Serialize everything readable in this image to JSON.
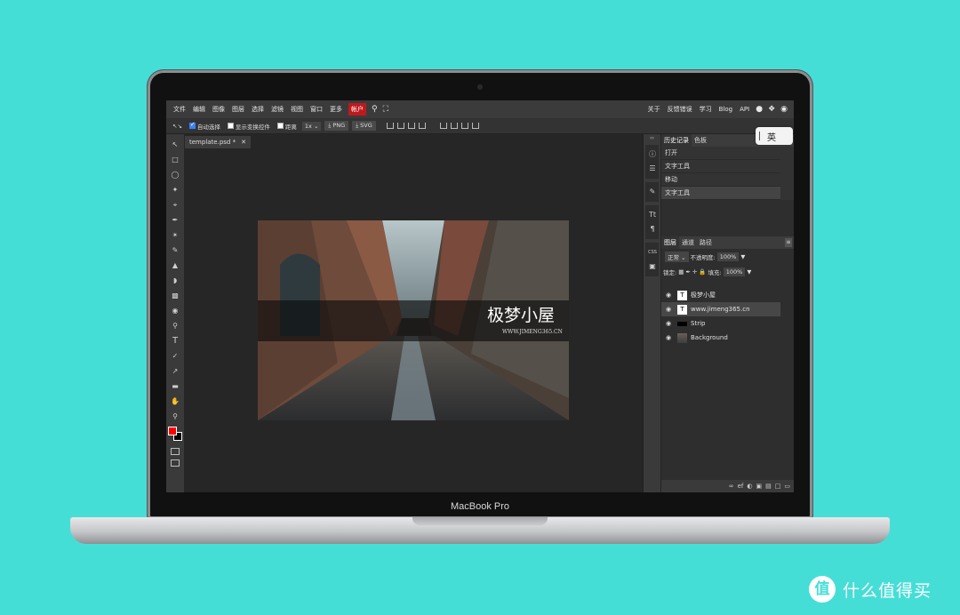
{
  "menubar": {
    "items": [
      "文件",
      "编辑",
      "图像",
      "图层",
      "选择",
      "滤镜",
      "视图",
      "窗口",
      "更多"
    ],
    "account": "帐户",
    "right_items": [
      "关于",
      "反馈错误",
      "学习",
      "Blog",
      "API"
    ]
  },
  "toolbar": {
    "auto_select": "自动选择",
    "show_transform": "显示变换控件",
    "distance": "距离",
    "zoom": "1x",
    "png": "PNG",
    "svg": "SVG"
  },
  "document_tab": "template.psd *",
  "canvas": {
    "title": "极梦小屋",
    "url": "WWW.JIMENG365.CN"
  },
  "history_panel": {
    "tabs": [
      "历史记录",
      "色板"
    ],
    "items": [
      "打开",
      "文字工具",
      "移动",
      "文字工具"
    ]
  },
  "layers_panel": {
    "tabs": [
      "图层",
      "通道",
      "路径"
    ],
    "blend_mode": "正常",
    "opacity_label": "不透明度:",
    "opacity_value": "100%",
    "lock_label": "锁定:",
    "fill_label": "填充:",
    "fill_value": "100%",
    "layers": [
      {
        "name": "极梦小屋",
        "thumb": "T"
      },
      {
        "name": "www.jimeng365.cn",
        "thumb": "T"
      },
      {
        "name": "Strip",
        "thumb": ""
      },
      {
        "name": "Background",
        "thumb": ""
      }
    ]
  },
  "ime": "英",
  "laptop_label": "MacBook Pro",
  "watermark": {
    "icon": "值",
    "text": "什么值得买"
  }
}
